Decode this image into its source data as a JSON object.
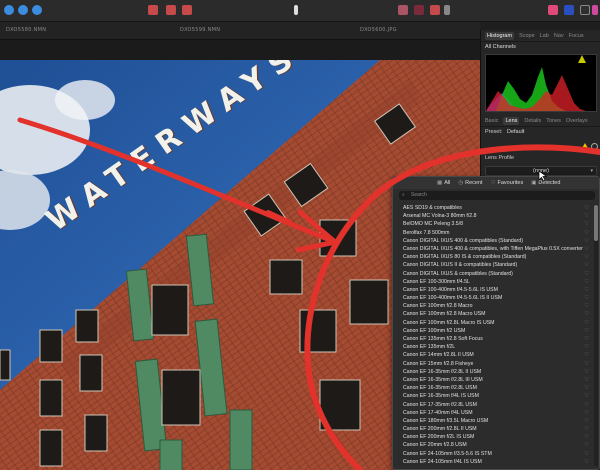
{
  "film_strip": {
    "labels": [
      "DXO5580.NMN",
      "DXO5599.NMN",
      "DXO5600.JPG"
    ]
  },
  "canvas": {
    "sign_text": "WATERWAYS"
  },
  "panel": {
    "top_tabs": [
      "Histogram",
      "Scope",
      "Lab",
      "Nav",
      "Focus"
    ],
    "active_top_tab": "Histogram",
    "channel": "All Channels",
    "develop_tabs": [
      "Basic",
      "Lens",
      "Details",
      "Tones",
      "Overlays"
    ],
    "active_develop_tab": "Lens",
    "preset_label": "Preset:",
    "preset_value": "Default",
    "lens_profile_label": "Lens Profile",
    "lens_profile_value": "(none)"
  },
  "dropdown": {
    "filters": [
      "All",
      "Recent",
      "Favourites",
      "Detected"
    ],
    "search_placeholder": "Search",
    "items": [
      "AES SD19 & compatibles",
      "Arsenal MC Volna-3 80mm f/2.8",
      "BelOMO MC Peleng 3.5/8",
      "Berolfax 7.8 500mm",
      "Canon DIGITAL IXUS 400 & compatibles (Standard)",
      "Canon DIGITAL IXUS 400 & compatibles, with Tiffen MegaPlus 0.5X converter",
      "Canon DIGITAL IXUS 80 IS & compatibles (Standard)",
      "Canon DIGITAL IXUS II & compatibles (Standard)",
      "Canon DIGITAL IXUS & compatibles (Standard)",
      "Canon EF 100-300mm f/4.5L",
      "Canon EF 100-400mm f/4.5-5.6L IS USM",
      "Canon EF 100-400mm f/4.5-5.6L IS II USM",
      "Canon EF 100mm f/2.8 Macro",
      "Canon EF 100mm f/2.8 Macro USM",
      "Canon EF 100mm f/2.8L Macro IS USM",
      "Canon EF 100mm f/2 USM",
      "Canon EF 135mm f/2.8 Soft Focus",
      "Canon EF 135mm f/2L",
      "Canon EF 14mm f/2.8L II USM",
      "Canon EF 15mm f/2.8 Fisheye",
      "Canon EF 16-35mm f/2.8L II USM",
      "Canon EF 16-35mm f/2.8L III USM",
      "Canon EF 16-35mm f/2.8L USM",
      "Canon EF 16-35mm f/4L IS USM",
      "Canon EF 17-35mm f/2.8L USM",
      "Canon EF 17-40mm f/4L USM",
      "Canon EF 180mm f/3.5L Macro USM",
      "Canon EF 200mm f/2.8L II USM",
      "Canon EF 200mm f/2L IS USM",
      "Canon EF 20mm f/2.8 USM",
      "Canon EF 24-105mm f/3.5-5.6 IS STM",
      "Canon EF 24-105mm f/4L IS USM"
    ]
  },
  "colors": {
    "accent": "#e2322b",
    "highlight_warning": "#f2c200",
    "panel_bg": "#262626",
    "dropdown_bg": "#2c2c2c"
  }
}
